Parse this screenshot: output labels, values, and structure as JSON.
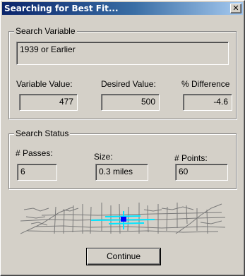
{
  "window": {
    "title": "Searching for Best Fit...",
    "close_glyph": "✕"
  },
  "search_variable": {
    "group_label": "Search Variable",
    "variable_name": "1939 or Earlier",
    "variable_value_label": "Variable Value:",
    "variable_value": "477",
    "desired_value_label": "Desired Value:",
    "desired_value": "500",
    "difference_label": "% Difference",
    "difference_value": "-4.6"
  },
  "search_status": {
    "group_label": "Search Status",
    "passes_label": "# Passes:",
    "passes_value": "6",
    "size_label": "Size:",
    "size_value": "0.3 miles",
    "points_label": "# Points:",
    "points_value": "60"
  },
  "map_preview": {
    "icon": "street-map-preview",
    "highlight_color": "#00e5ff",
    "marker_color": "#0000ff",
    "street_color": "#7a7a7a"
  },
  "actions": {
    "continue_label": "Continue"
  },
  "colors": {
    "titlebar_start": "#0a246a",
    "titlebar_end": "#a6caf0",
    "dialog_face": "#d4d0c8"
  }
}
